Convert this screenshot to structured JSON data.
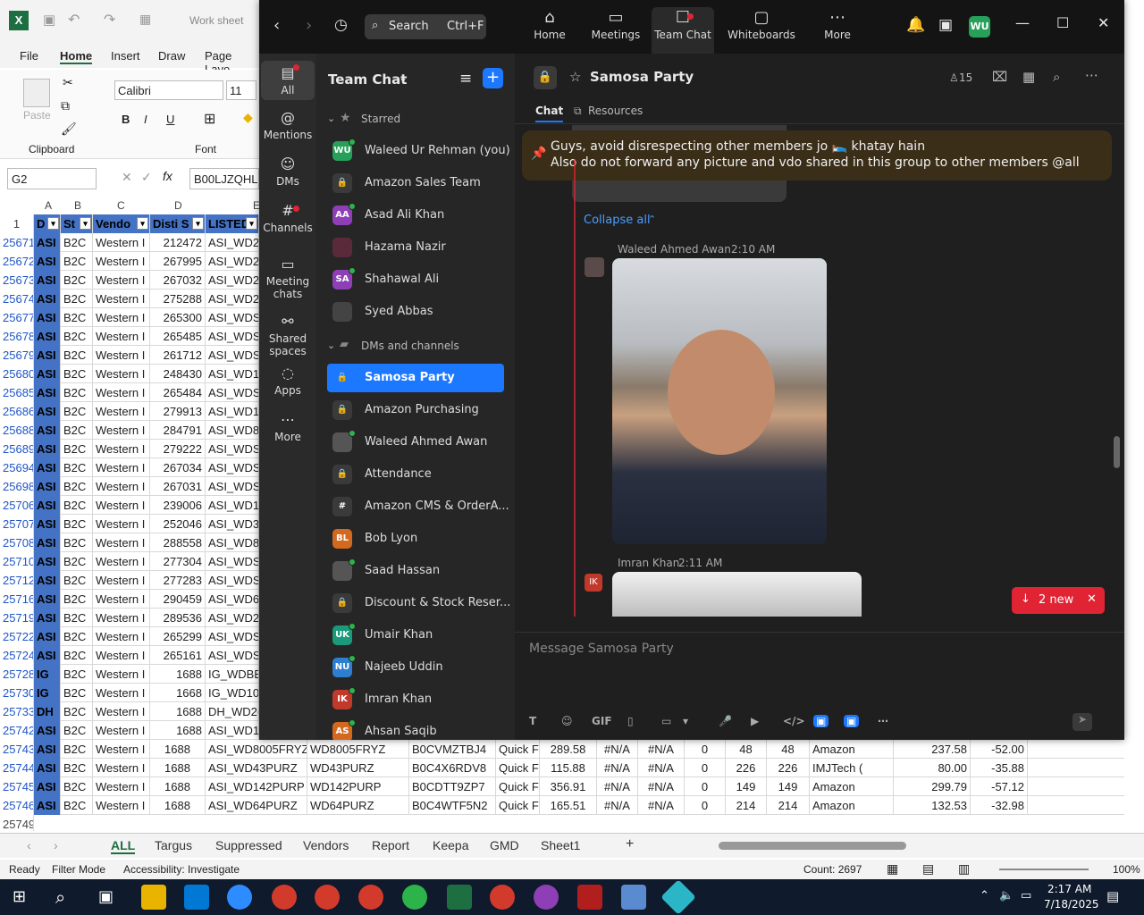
{
  "excel": {
    "quick_title": "Work sheet",
    "tabs": [
      "File",
      "Home",
      "Insert",
      "Draw",
      "Page Layo"
    ],
    "font_name": "Calibri",
    "font_size": "11",
    "groups": [
      "Clipboard",
      "Font"
    ],
    "paste_label": "Paste",
    "name_box": "G2",
    "formula": "B00LJZQHL6",
    "fx": "fx",
    "col_letters": [
      "A",
      "B",
      "C",
      "D",
      "E"
    ],
    "headers": [
      "D",
      "St",
      "Vendo",
      "Disti S",
      "LISTEDSI"
    ],
    "header_row_num": "1",
    "rows": [
      [
        "25671",
        "ASI",
        "B2C",
        "Western I",
        "212472",
        "ASI_WD2"
      ],
      [
        "25672",
        "ASI",
        "B2C",
        "Western I",
        "267995",
        "ASI_WD2"
      ],
      [
        "25673",
        "ASI",
        "B2C",
        "Western I",
        "267032",
        "ASI_WD2"
      ],
      [
        "25674",
        "ASI",
        "B2C",
        "Western I",
        "275288",
        "ASI_WD2"
      ],
      [
        "25677",
        "ASI",
        "B2C",
        "Western I",
        "265300",
        "ASI_WDS"
      ],
      [
        "25678",
        "ASI",
        "B2C",
        "Western I",
        "265485",
        "ASI_WDS"
      ],
      [
        "25679",
        "ASI",
        "B2C",
        "Western I",
        "261712",
        "ASI_WDS"
      ],
      [
        "25680",
        "ASI",
        "B2C",
        "Western I",
        "248430",
        "ASI_WD1"
      ],
      [
        "25685",
        "ASI",
        "B2C",
        "Western I",
        "265484",
        "ASI_WDS"
      ],
      [
        "25686",
        "ASI",
        "B2C",
        "Western I",
        "279913",
        "ASI_WD1"
      ],
      [
        "25688",
        "ASI",
        "B2C",
        "Western I",
        "284791",
        "ASI_WD8"
      ],
      [
        "25689",
        "ASI",
        "B2C",
        "Western I",
        "279222",
        "ASI_WDS"
      ],
      [
        "25694",
        "ASI",
        "B2C",
        "Western I",
        "267034",
        "ASI_WDS"
      ],
      [
        "25698",
        "ASI",
        "B2C",
        "Western I",
        "267031",
        "ASI_WDS"
      ],
      [
        "25706",
        "ASI",
        "B2C",
        "Western I",
        "239006",
        "ASI_WD1"
      ],
      [
        "25707",
        "ASI",
        "B2C",
        "Western I",
        "252046",
        "ASI_WD3"
      ],
      [
        "25708",
        "ASI",
        "B2C",
        "Western I",
        "288558",
        "ASI_WD8"
      ],
      [
        "25710",
        "ASI",
        "B2C",
        "Western I",
        "277304",
        "ASI_WDS"
      ],
      [
        "25712",
        "ASI",
        "B2C",
        "Western I",
        "277283",
        "ASI_WDS"
      ],
      [
        "25716",
        "ASI",
        "B2C",
        "Western I",
        "290459",
        "ASI_WD6"
      ],
      [
        "25719",
        "ASI",
        "B2C",
        "Western I",
        "289536",
        "ASI_WD2"
      ],
      [
        "25722",
        "ASI",
        "B2C",
        "Western I",
        "265299",
        "ASI_WDS"
      ],
      [
        "25724",
        "ASI",
        "B2C",
        "Western I",
        "265161",
        "ASI_WDS"
      ],
      [
        "25728",
        "IG",
        "B2C",
        "Western I",
        "1688",
        "IG_WDBB"
      ],
      [
        "25730",
        "IG",
        "B2C",
        "Western I",
        "1668",
        "IG_WD10"
      ],
      [
        "25733",
        "DH",
        "B2C",
        "Western I",
        "1688",
        "DH_WD2("
      ],
      [
        "25742",
        "ASI",
        "B2C",
        "Western I",
        "1688",
        "ASI_WD1"
      ]
    ],
    "wide_rows": [
      [
        "25743",
        "ASI",
        "B2C",
        "Western I",
        "1688",
        "ASI_WD8005FRYZ",
        "WD8005FRYZ",
        "B0CVMZTBJ4",
        "Quick F",
        "289.58",
        "#N/A",
        "#N/A",
        "0",
        "48",
        "48",
        "Amazon",
        "237.58",
        "-52.00"
      ],
      [
        "25744",
        "ASI",
        "B2C",
        "Western I",
        "1688",
        "ASI_WD43PURZ",
        "WD43PURZ",
        "B0C4X6RDV8",
        "Quick F",
        "115.88",
        "#N/A",
        "#N/A",
        "0",
        "226",
        "226",
        "IMJTech (",
        "80.00",
        "-35.88"
      ],
      [
        "25745",
        "ASI",
        "B2C",
        "Western I",
        "1688",
        "ASI_WD142PURP",
        "WD142PURP",
        "B0CDTT9ZP7",
        "Quick F",
        "356.91",
        "#N/A",
        "#N/A",
        "0",
        "149",
        "149",
        "Amazon",
        "299.79",
        "-57.12"
      ],
      [
        "25746",
        "ASI",
        "B2C",
        "Western I",
        "1688",
        "ASI_WD64PURZ",
        "WD64PURZ",
        "B0C4WTF5N2",
        "Quick F",
        "165.51",
        "#N/A",
        "#N/A",
        "0",
        "214",
        "214",
        "Amazon",
        "132.53",
        "-32.98"
      ]
    ],
    "last_row": "25749",
    "sheets": [
      "ALL",
      "Targus",
      "Suppressed",
      "Vendors",
      "Report",
      "Keepa",
      "GMD",
      "Sheet1"
    ],
    "status": {
      "ready": "Ready",
      "filter": "Filter Mode",
      "access": "Accessibility: Investigate",
      "count": "Count: 2697",
      "zoom": "100%"
    }
  },
  "zoom": {
    "search_label": "Search",
    "search_shortcut": "Ctrl+F",
    "nav": [
      {
        "label": "Home",
        "icon": "⌂"
      },
      {
        "label": "Meetings",
        "icon": "▭"
      },
      {
        "label": "Team Chat",
        "icon": "☐"
      },
      {
        "label": "Whiteboards",
        "icon": "▢"
      },
      {
        "label": "More",
        "icon": "⋯"
      }
    ],
    "avatar": "WU",
    "rail": [
      {
        "label": "All",
        "icon": "▤"
      },
      {
        "label": "Mentions",
        "icon": "@"
      },
      {
        "label": "DMs",
        "icon": "☺"
      },
      {
        "label": "Channels",
        "icon": "#"
      },
      {
        "label": "Meeting chats",
        "icon": "▭"
      },
      {
        "label": "Shared spaces",
        "icon": "⚯"
      },
      {
        "label": "Apps",
        "icon": "◌"
      },
      {
        "label": "More",
        "icon": "⋯"
      }
    ],
    "list_title": "Team Chat",
    "section_starred": "Starred",
    "section_dms": "DMs and channels",
    "starred": [
      {
        "name": "Waleed Ur Rehman (you)",
        "init": "WU",
        "color": "#27a05a",
        "online": true
      },
      {
        "name": "Amazon Sales Team",
        "init": "🔒",
        "color": "#3a3a3a",
        "online": false
      },
      {
        "name": "Asad Ali Khan",
        "init": "AA",
        "color": "#8e3fb5",
        "online": true
      },
      {
        "name": "Hazama Nazir",
        "init": "",
        "color": "#5a2a3a",
        "online": false
      },
      {
        "name": "Shahawal Ali",
        "init": "SA",
        "color": "#8e3fb5",
        "online": true
      },
      {
        "name": "Syed Abbas",
        "init": "",
        "color": "#444",
        "online": false
      }
    ],
    "channels": [
      {
        "name": "Samosa Party",
        "init": "🔒",
        "color": "#1c78ff",
        "online": false,
        "active": true
      },
      {
        "name": "Amazon Purchasing",
        "init": "🔒",
        "color": "#3a3a3a",
        "online": false
      },
      {
        "name": "Waleed Ahmed Awan",
        "init": "",
        "color": "#555",
        "online": true
      },
      {
        "name": "Attendance",
        "init": "🔒",
        "color": "#3a3a3a",
        "online": false
      },
      {
        "name": "Amazon CMS & OrderA...",
        "init": "#",
        "color": "#3a3a3a",
        "online": false
      },
      {
        "name": "Bob Lyon",
        "init": "BL",
        "color": "#d2691e",
        "online": false
      },
      {
        "name": "Saad Hassan",
        "init": "",
        "color": "#555",
        "online": true
      },
      {
        "name": "Discount & Stock Reser...",
        "init": "🔒",
        "color": "#3a3a3a",
        "online": false
      },
      {
        "name": "Umair Khan",
        "init": "UK",
        "color": "#1a9a7a",
        "online": true
      },
      {
        "name": "Najeeb Uddin",
        "init": "NU",
        "color": "#2d7fd0",
        "online": true
      },
      {
        "name": "Imran Khan",
        "init": "IK",
        "color": "#c0392b",
        "online": true
      },
      {
        "name": "Ahsan Saqib",
        "init": "AS",
        "color": "#d2691e",
        "online": true
      }
    ],
    "chat_title": "Samosa Party",
    "member_count": "15",
    "chat_tabs": [
      "Chat",
      "Resources"
    ],
    "pinned_line1": "Guys, avoid disrespecting other members jo 🛌 khatay hain",
    "pinned_line2": "Also do not forward any picture and vdo shared in this group to other members @all",
    "collapse": "Collapse all",
    "msg1_sender": "Waleed Ahmed Awan",
    "msg1_time": "2:10 AM",
    "msg2_sender": "Imran Khan",
    "msg2_time": "2:11 AM",
    "msg2_init": "IK",
    "new_badge": "2 new",
    "input_placeholder": "Message Samosa Party",
    "toolbar": [
      "T",
      "☺",
      "GIF",
      "▯",
      "▭",
      "▾",
      "🎤",
      "▶",
      "</>",
      "▣",
      "▣",
      "⋯"
    ]
  },
  "taskbar": {
    "time": "2:17 AM",
    "date": "7/18/2025"
  },
  "colors": {
    "accent": "#1c78ff",
    "zoom_bg": "#1f1f1f",
    "pin_bg": "#3a2e18",
    "badge_red": "#e02434"
  }
}
